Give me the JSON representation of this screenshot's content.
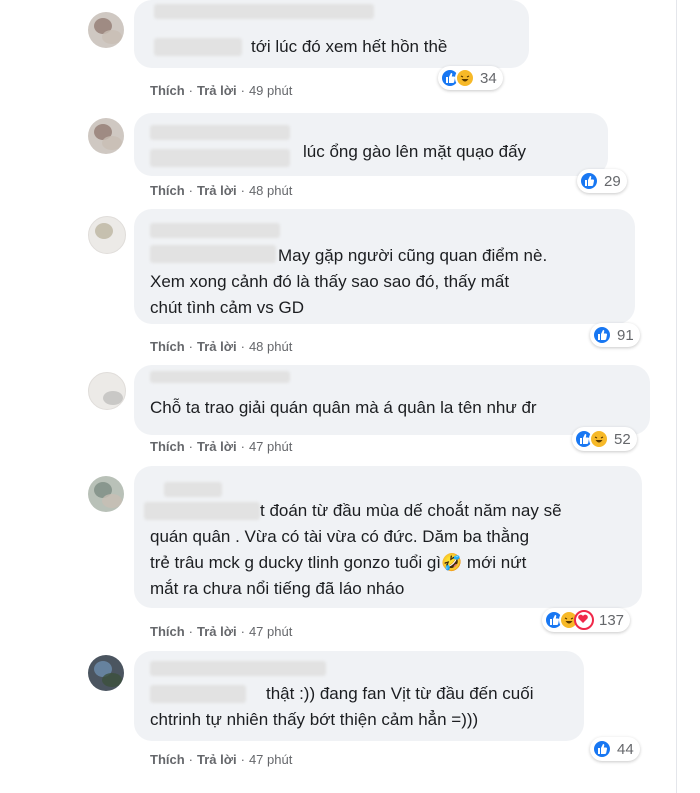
{
  "action_like": "Thích",
  "action_reply": "Trả lời",
  "comments": [
    {
      "text": "tới lúc đó xem hết hồn thề",
      "reactions": [
        "like",
        "haha"
      ],
      "count": "34",
      "time": "49 phút"
    },
    {
      "text": "lúc ổng gào lên mặt quạo đấy",
      "reactions": [
        "like"
      ],
      "count": "29",
      "time": "48 phút"
    },
    {
      "text": "May gặp người cũng quan điểm nè.\nXem xong cảnh đó là thấy sao sao đó, thấy mất\nchút tình cảm vs GD",
      "reactions": [
        "like"
      ],
      "count": "91",
      "time": "48 phút"
    },
    {
      "text": "Chỗ ta trao giải quán quân mà á quân la tên như đr",
      "reactions": [
        "like",
        "haha"
      ],
      "count": "52",
      "time": "47 phút"
    },
    {
      "text": "t đoán từ đầu mùa dế choắt năm nay sẽ\nquán quân . Vừa có tài vừa có đức. Dăm ba thằng\ntrẻ trâu mck g ducky tlinh gonzo tuổi gì🤣 mới nứt\nmắt ra chưa nổi tiếng đã láo nháo",
      "reactions": [
        "like",
        "haha",
        "love"
      ],
      "count": "137",
      "time": "47 phút"
    },
    {
      "text": "thật :)) đang fan Vịt từ đầu đến cuối\nchtrinh tự nhiên thấy bớt thiện cảm hẳn =)))",
      "reactions": [
        "like"
      ],
      "count": "44",
      "time": "47 phút"
    }
  ],
  "colors": {
    "like": "#1877f2",
    "haha": "#f7b928",
    "love": "#f02849",
    "bubble": "#f0f2f5"
  }
}
